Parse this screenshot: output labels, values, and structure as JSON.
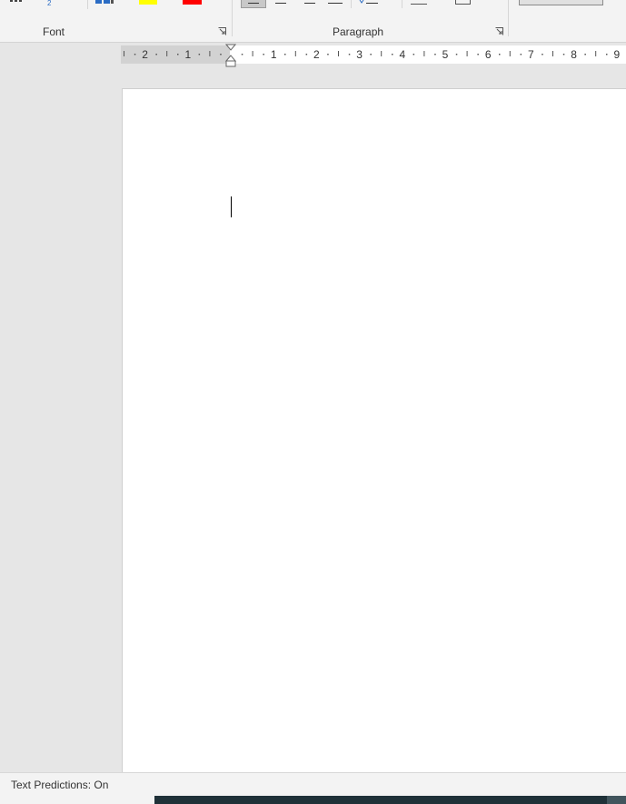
{
  "ribbon": {
    "groups": [
      {
        "label": "Font"
      },
      {
        "label": "Paragraph"
      }
    ],
    "colors": {
      "highlight": "#ffff00",
      "font_color": "#ff0000",
      "ribbon_bg": "#f3f3f3",
      "accent_blue": "#2b6cc4"
    },
    "icons": [
      "strikethrough-icon",
      "subscript-icon",
      "text-effects-icon",
      "highlight-color-icon",
      "font-color-icon",
      "align-left-icon",
      "align-center-icon",
      "align-right-icon",
      "justify-icon",
      "line-spacing-icon",
      "shading-icon",
      "borders-icon",
      "font-dialog-launcher-icon",
      "paragraph-dialog-launcher-icon"
    ]
  },
  "ruler": {
    "numbers": [
      "2",
      "1",
      "1",
      "2",
      "3",
      "4",
      "5",
      "6",
      "7",
      "8",
      "9"
    ]
  },
  "statusbar": {
    "text_predictions": "Text Predictions: On"
  }
}
